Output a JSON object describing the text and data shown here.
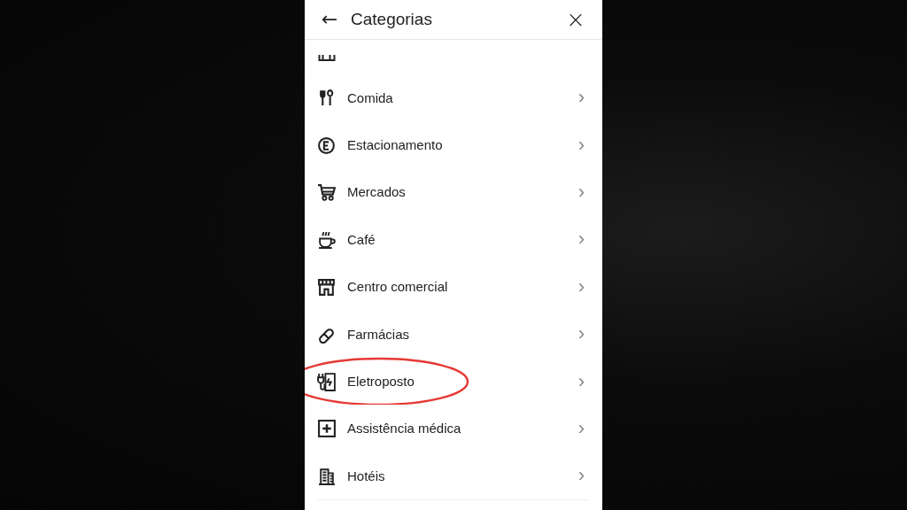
{
  "header": {
    "back": "←",
    "title": "Categorias",
    "close": "×"
  },
  "items": [
    {
      "label": "Comida",
      "chevron": "›",
      "highlighted": false
    },
    {
      "label": "Estacionamento",
      "chevron": "›",
      "highlighted": false
    },
    {
      "label": "Mercados",
      "chevron": "›",
      "highlighted": false
    },
    {
      "label": "Café",
      "chevron": "›",
      "highlighted": false
    },
    {
      "label": "Centro comercial",
      "chevron": "›",
      "highlighted": false
    },
    {
      "label": "Farmácias",
      "chevron": "›",
      "highlighted": false
    },
    {
      "label": "Eletroposto",
      "chevron": "›",
      "highlighted": true
    },
    {
      "label": "Assistência médica",
      "chevron": "›",
      "highlighted": false
    },
    {
      "label": "Hotéis",
      "chevron": "›",
      "highlighted": false
    }
  ]
}
